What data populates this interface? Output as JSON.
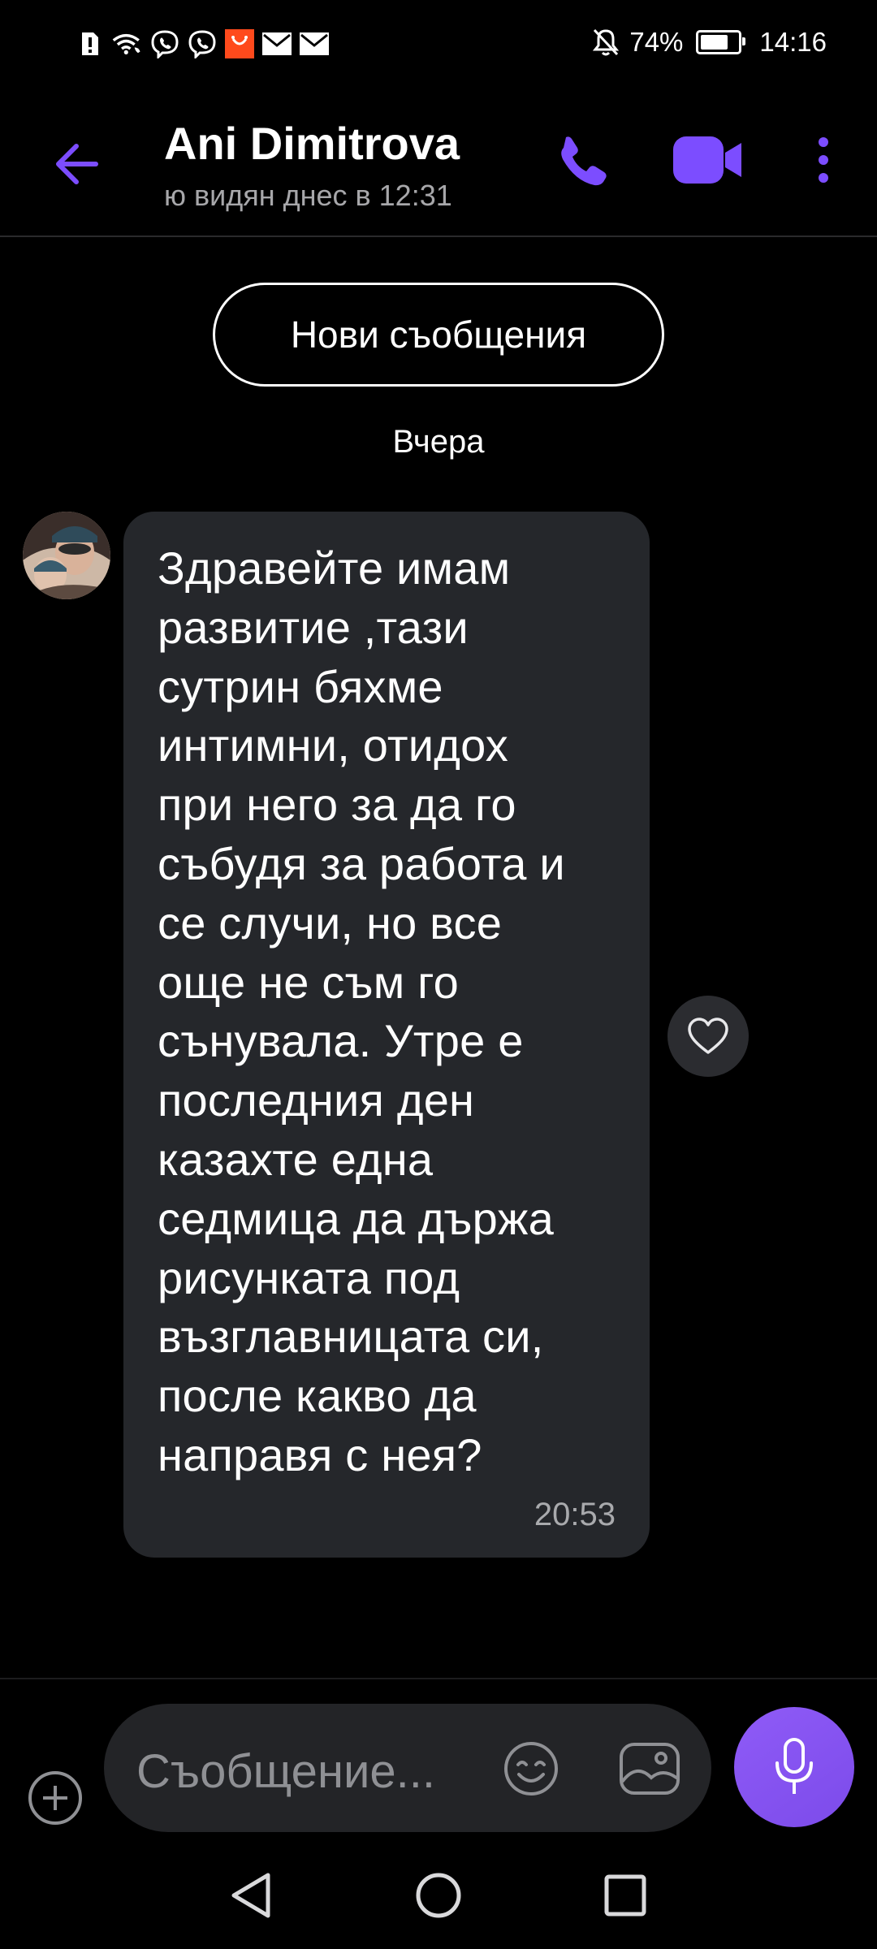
{
  "status_bar": {
    "battery_percent": "74%",
    "battery_level": 0.74,
    "time": "14:16",
    "left_icons": [
      "alert-sim-icon",
      "wifi-call-icon",
      "viber-icon",
      "viber-icon",
      "app-notification-icon",
      "mail-icon",
      "mail-icon"
    ],
    "right_icons": [
      "mute-bell-icon",
      "battery-icon"
    ]
  },
  "header": {
    "contact_name": "Ani Dimitrova",
    "last_seen": "ю видян днес в 12:31",
    "accent_color": "#7c4dff"
  },
  "chat": {
    "new_messages_label": "Нови съобщения",
    "date_separator": "Вчера",
    "messages": [
      {
        "text": "Здравейте имам\nразвитие ,тази\nсутрин бяхме\nинтимни, отидох\nпри него за да го\nсъбудя за работа и\nсе случи, но все\nоще не съм го\nсънувала. Утре е\nпоследния ден\nказахте една\nседмица да държа\nрисунката под\nвъзглавницата си,\nпосле какво да\nнаправя с нея?",
        "time": "20:53",
        "bubble_color": "#25272b"
      }
    ]
  },
  "composer": {
    "placeholder": "Съобщение..."
  },
  "navigation": {
    "buttons": [
      "back-nav-icon",
      "home-nav-icon",
      "recents-nav-icon"
    ]
  }
}
